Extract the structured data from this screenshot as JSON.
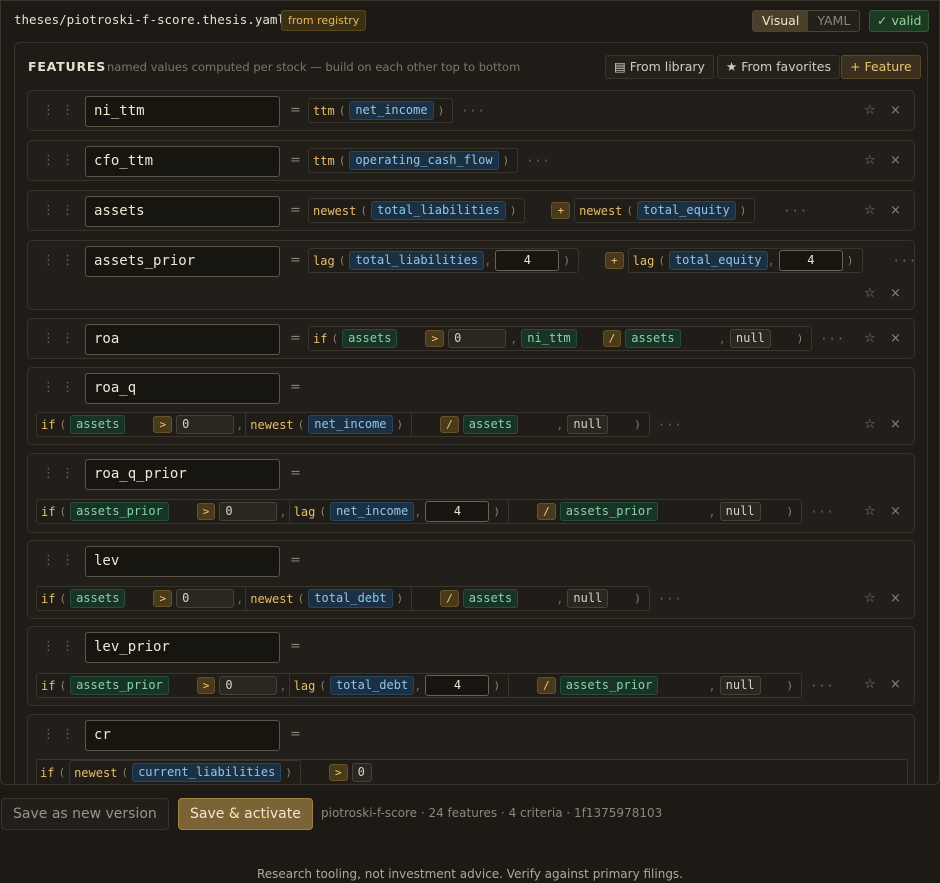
{
  "header": {
    "file_path": "theses/piotroski-f-score.thesis.yaml",
    "registry_badge": "from registry",
    "view_visual": "Visual",
    "view_yaml": "YAML",
    "valid_badge": "✓ valid"
  },
  "features_panel": {
    "title": "FEATURES",
    "subtitle": "named values computed per stock — build on each other top to bottom",
    "from_library": "From library",
    "from_favorites": "From favorites",
    "add_feature": "Feature"
  },
  "glyphs": {
    "drag": "⋮ ⋮",
    "eq": "=",
    "star": "☆",
    "close": "×",
    "more": "···",
    "open": "(",
    "shut": ")",
    "comma": ",",
    "library_icon": "▤",
    "favorites_icon": "★",
    "plus_icon": "+"
  },
  "features": [
    {
      "name": "ni_ttm",
      "fn": "ttm",
      "arg": "net_income"
    },
    {
      "name": "cfo_ttm",
      "fn": "ttm",
      "arg": "operating_cash_flow"
    },
    {
      "name": "assets",
      "fn1": "newest",
      "arg1": "total_liabilities",
      "op": "+",
      "fn2": "newest",
      "arg2": "total_equity"
    },
    {
      "name": "assets_prior",
      "fn1": "lag",
      "arg1": "total_liabilities",
      "n1": "4",
      "op": "+",
      "fn2": "lag",
      "arg2": "total_equity",
      "n2": "4"
    },
    {
      "name": "roa",
      "fn": "if",
      "cond_lhs": "assets",
      "cond_op": ">",
      "cond_rhs": "0",
      "then_lhs": "ni_ttm",
      "then_op": "/",
      "then_rhs": "assets",
      "else": "null"
    },
    {
      "name": "roa_q",
      "fn": "if",
      "cond_lhs": "assets",
      "cond_op": ">",
      "cond_rhs": "0",
      "inner_fn": "newest",
      "inner_arg": "net_income",
      "then_op": "/",
      "then_rhs": "assets",
      "else": "null"
    },
    {
      "name": "roa_q_prior",
      "fn": "if",
      "cond_lhs": "assets_prior",
      "cond_op": ">",
      "cond_rhs": "0",
      "inner_fn": "lag",
      "inner_arg": "net_income",
      "inner_n": "4",
      "then_op": "/",
      "then_rhs": "assets_prior",
      "else": "null"
    },
    {
      "name": "lev",
      "fn": "if",
      "cond_lhs": "assets",
      "cond_op": ">",
      "cond_rhs": "0",
      "inner_fn": "newest",
      "inner_arg": "total_debt",
      "then_op": "/",
      "then_rhs": "assets",
      "else": "null"
    },
    {
      "name": "lev_prior",
      "fn": "if",
      "cond_lhs": "assets_prior",
      "cond_op": ">",
      "cond_rhs": "0",
      "inner_fn": "lag",
      "inner_arg": "total_debt",
      "inner_n": "4",
      "then_op": "/",
      "then_rhs": "assets_prior",
      "else": "null"
    },
    {
      "name": "cr",
      "fn": "if",
      "inner_fn": "newest",
      "inner_arg": "current_liabilities",
      "cond_op": ">",
      "cond_rhs": "0"
    }
  ],
  "actions": {
    "save_new": "Save as new version",
    "save_activate": "Save & activate",
    "status": "piotroski-f-score · 24 features · 4 criteria · 1f1375978103"
  },
  "footer": "Research tooling, not investment advice. Verify against primary filings."
}
